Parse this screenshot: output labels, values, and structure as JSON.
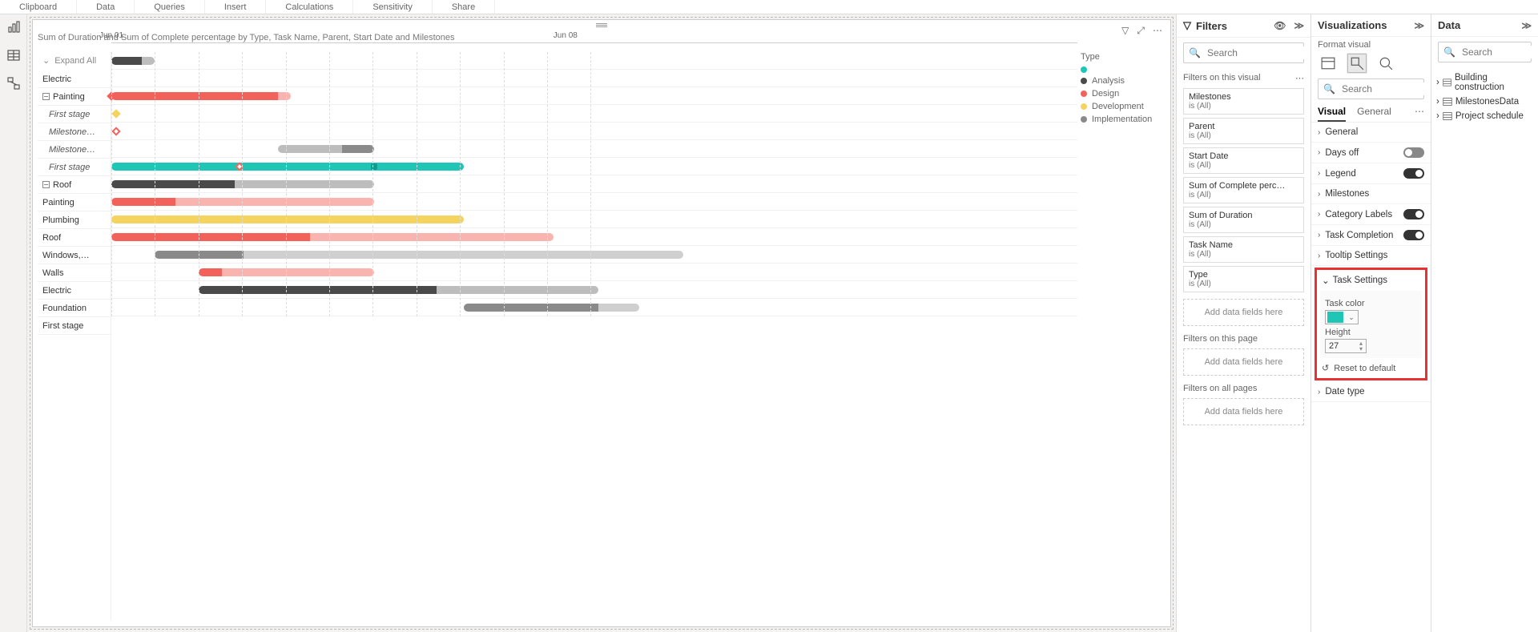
{
  "ribbon": {
    "tabs": [
      "Clipboard",
      "Data",
      "Queries",
      "Insert",
      "Calculations",
      "Sensitivity",
      "Share"
    ]
  },
  "visual": {
    "title": "Sum of Duration and Sum of Complete percentage by Type, Task Name, Parent, Start Date and Milestones",
    "expand_all": "Expand All",
    "date_ticks": [
      {
        "label": "Jun 01",
        "pct": 0
      },
      {
        "label": "Jun 08",
        "pct": 47
      }
    ],
    "legend_title": "Type",
    "legend": [
      {
        "label": "",
        "color": "#1fc6b6"
      },
      {
        "label": "Analysis",
        "color": "#4a4a4a"
      },
      {
        "label": "Design",
        "color": "#f2625a"
      },
      {
        "label": "Development",
        "color": "#f4d35e"
      },
      {
        "label": "Implementation",
        "color": "#8a8a8a"
      }
    ]
  },
  "chart_data": {
    "type": "gantt",
    "x_unit": "days",
    "x_origin": "Jun 01",
    "ylim_days": [
      0,
      14.5
    ],
    "rows": [
      {
        "label": "Electric",
        "kind": "group",
        "segments": [
          {
            "start": 0,
            "end": 2.4,
            "color": "#4a4a4a"
          },
          {
            "start": 2.4,
            "end": 3.4,
            "color": "#bdbdbd"
          }
        ]
      },
      {
        "label": "Painting",
        "kind": "collapsible"
      },
      {
        "label": "First stage",
        "kind": "child",
        "segments": [
          {
            "start": 0,
            "end": 13,
            "color": "#f2625a"
          },
          {
            "start": 13,
            "end": 14,
            "color": "#f9b4b0"
          }
        ],
        "milestones": [
          {
            "x": 0,
            "color": "#f2625a",
            "fill": true
          }
        ]
      },
      {
        "label": "Milestone…",
        "kind": "child",
        "milestones": [
          {
            "x": 0.4,
            "color": "#f4d35e",
            "fill": true
          }
        ]
      },
      {
        "label": "Milestone…",
        "kind": "child",
        "milestones": [
          {
            "x": 0.4,
            "color": "#f2625a",
            "fill": false
          }
        ]
      },
      {
        "label": "First stage",
        "kind": "child",
        "segments": [
          {
            "start": 13,
            "end": 18,
            "color": "#bdbdbd"
          },
          {
            "start": 18,
            "end": 20.5,
            "color": "#8a8a8a"
          }
        ]
      },
      {
        "label": "Roof",
        "kind": "collapsible",
        "segments": [
          {
            "start": 0,
            "end": 27.5,
            "color": "#1fc6b6"
          }
        ],
        "milestones": [
          {
            "x": 10,
            "color": "#f2625a",
            "fill": false
          },
          {
            "x": 20.5,
            "color": "#129c8e",
            "fill": true,
            "square": true
          }
        ]
      },
      {
        "label": "Painting",
        "kind": "row",
        "segments": [
          {
            "start": 0,
            "end": 9.6,
            "color": "#4a4a4a"
          },
          {
            "start": 9.6,
            "end": 20.5,
            "color": "#bdbdbd"
          }
        ]
      },
      {
        "label": "Plumbing",
        "kind": "row",
        "segments": [
          {
            "start": 0,
            "end": 5,
            "color": "#f2625a"
          },
          {
            "start": 5,
            "end": 20.5,
            "color": "#f9b4b0"
          }
        ]
      },
      {
        "label": "Roof",
        "kind": "row",
        "segments": [
          {
            "start": 0,
            "end": 27.5,
            "color": "#f4d35e"
          }
        ]
      },
      {
        "label": "Windows,…",
        "kind": "row",
        "segments": [
          {
            "start": 0,
            "end": 15.5,
            "color": "#f2625a"
          },
          {
            "start": 15.5,
            "end": 34.5,
            "color": "#f9b4b0"
          }
        ]
      },
      {
        "label": "Walls",
        "kind": "row",
        "segments": [
          {
            "start": 3.4,
            "end": 10.3,
            "color": "#8a8a8a"
          },
          {
            "start": 10.3,
            "end": 44.6,
            "color": "#cfcfcf"
          }
        ]
      },
      {
        "label": "Electric",
        "kind": "row",
        "segments": [
          {
            "start": 6.8,
            "end": 8.6,
            "color": "#f2625a"
          },
          {
            "start": 8.6,
            "end": 20.5,
            "color": "#f9b4b0"
          }
        ]
      },
      {
        "label": "Foundation",
        "kind": "row",
        "segments": [
          {
            "start": 6.8,
            "end": 25.4,
            "color": "#4a4a4a"
          },
          {
            "start": 25.4,
            "end": 38,
            "color": "#bdbdbd"
          }
        ]
      },
      {
        "label": "First stage",
        "kind": "row",
        "segments": [
          {
            "start": 27.5,
            "end": 38,
            "color": "#8a8a8a"
          },
          {
            "start": 38,
            "end": 41.2,
            "color": "#cfcfcf"
          }
        ]
      }
    ]
  },
  "filters": {
    "title": "Filters",
    "search_placeholder": "Search",
    "sections": {
      "visual": "Filters on this visual",
      "page": "Filters on this page",
      "all": "Filters on all pages"
    },
    "is_all": "is (All)",
    "cards": [
      "Milestones",
      "Parent",
      "Start Date",
      "Sum of Complete perc…",
      "Sum of Duration",
      "Task Name",
      "Type"
    ],
    "add": "Add data fields here"
  },
  "viz": {
    "title": "Visualizations",
    "subtitle": "Format visual",
    "search_placeholder": "Search",
    "tabs": {
      "visual": "Visual",
      "general": "General"
    },
    "props": [
      {
        "label": "General",
        "toggle": null,
        "expanded": false
      },
      {
        "label": "Days off",
        "toggle": "off",
        "expanded": false
      },
      {
        "label": "Legend",
        "toggle": "on",
        "expanded": false
      },
      {
        "label": "Milestones",
        "toggle": null,
        "expanded": false
      },
      {
        "label": "Category Labels",
        "toggle": "on",
        "expanded": false
      },
      {
        "label": "Task Completion",
        "toggle": "on",
        "expanded": false
      },
      {
        "label": "Tooltip Settings",
        "toggle": null,
        "expanded": false
      }
    ],
    "task_settings": {
      "header": "Task Settings",
      "task_color_label": "Task color",
      "task_color": "#1fc6b6",
      "height_label": "Height",
      "height_value": "27",
      "reset": "Reset to default"
    },
    "date_type": "Date type"
  },
  "data": {
    "title": "Data",
    "search_placeholder": "Search",
    "tables": [
      "Building construction",
      "MilestonesData",
      "Project schedule"
    ]
  }
}
